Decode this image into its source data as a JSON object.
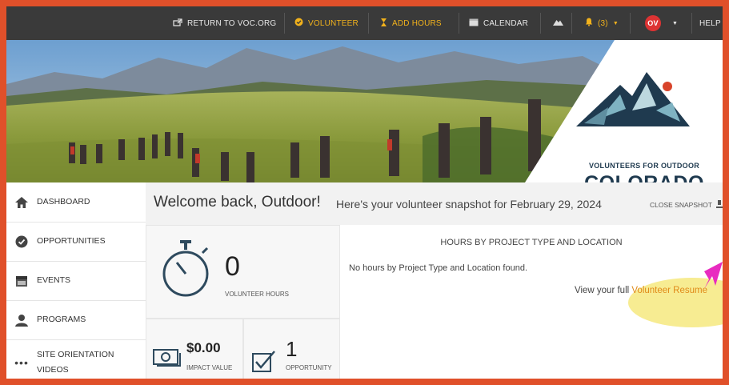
{
  "nav": {
    "return": "RETURN TO VOC.ORG",
    "volunteer": "VOLUNTEER",
    "add_hours": "ADD HOURS",
    "calendar": "CALENDAR",
    "notifications": "(3)",
    "avatar": "OV",
    "help": "HELP"
  },
  "logo": {
    "line1": "VOLUNTEERS FOR OUTDOOR",
    "line2": "COLORADO"
  },
  "sidebar": {
    "items": [
      {
        "label": "DASHBOARD",
        "icon": "home-icon"
      },
      {
        "label": "OPPORTUNITIES",
        "icon": "check-circle-icon"
      },
      {
        "label": "EVENTS",
        "icon": "calendar-icon"
      },
      {
        "label": "PROGRAMS",
        "icon": "people-icon"
      },
      {
        "label": "SITE ORIENTATION VIDEOS",
        "icon": "dots-icon"
      }
    ]
  },
  "main": {
    "welcome": "Welcome back, Outdoor!",
    "snapshot": "Here's your volunteer snapshot for February 29, 2024",
    "close_snapshot": "CLOSE SNAPSHOT",
    "hours": {
      "value": "0",
      "label": "VOLUNTEER HOURS"
    },
    "impact": {
      "value": "$0.00",
      "label": "IMPACT VALUE"
    },
    "responses": {
      "value": "1",
      "label": "OPPORTUNITY RESPONSES"
    },
    "panel_title": "HOURS BY PROJECT TYPE AND LOCATION",
    "panel_empty": "No hours by Project Type and Location found.",
    "resume_prefix": "View your full ",
    "resume_link": "Volunteer Resume"
  },
  "colors": {
    "border": "#e0502a",
    "nav_bg": "#3a3a3a",
    "accent": "#f2b21c",
    "highlight": "#f7ec92",
    "arrow": "#e82bc0"
  }
}
